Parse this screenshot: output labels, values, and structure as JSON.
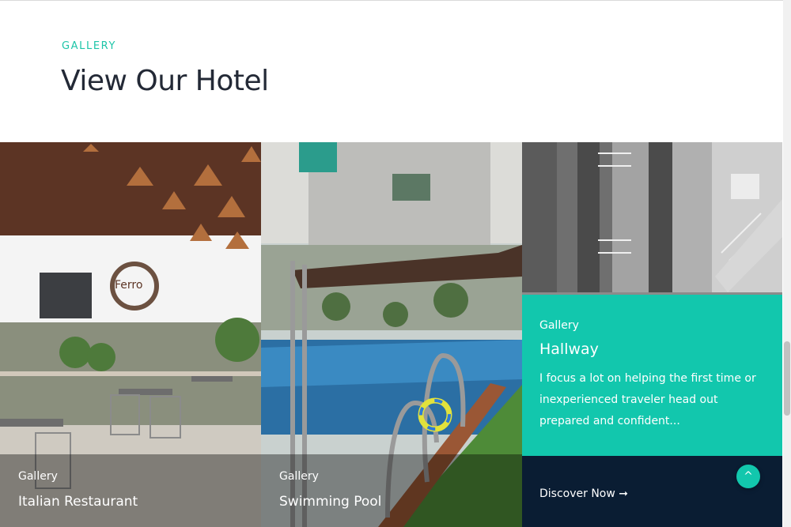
{
  "section": {
    "eyebrow": "GALLERY",
    "title": "View Our Hotel"
  },
  "cards": [
    {
      "category": "Gallery",
      "title": "Italian Restaurant"
    },
    {
      "category": "Gallery",
      "title": "Swimming Pool"
    },
    {
      "category": "Gallery",
      "title": "Hallway",
      "description": "I focus a lot on helping the first time or inexperienced traveler head out prepared and confident...",
      "cta_label": "Discover Now ➞"
    }
  ],
  "scroll_top": {
    "icon": "chevron-up-icon",
    "label": "^"
  },
  "colors": {
    "accent": "#12c7ad",
    "dark": "#0a1d33",
    "title": "#232936"
  }
}
